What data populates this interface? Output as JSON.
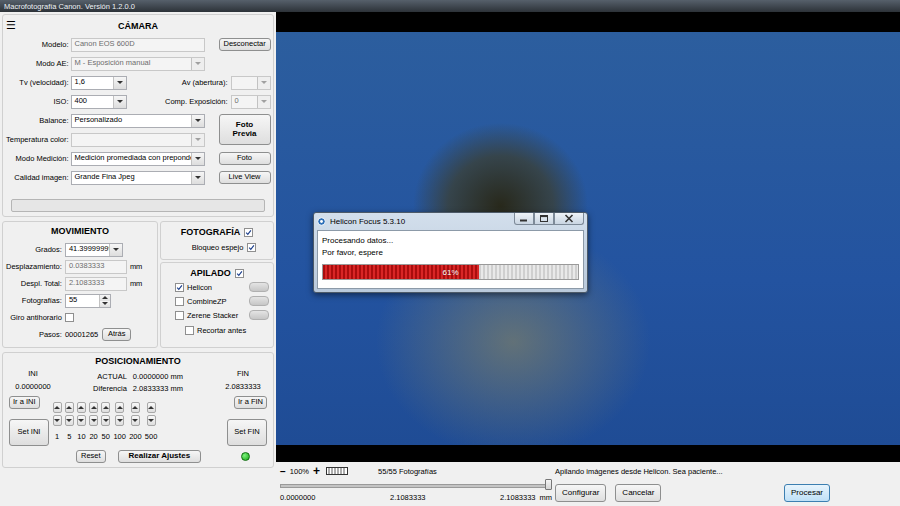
{
  "window": {
    "title": "Macrofotografía Canon. Versión 1.2.0.0"
  },
  "menu_icon": "☰",
  "camera": {
    "title": "CÁMARA",
    "rows": [
      {
        "kind": "text",
        "label": "Modelo:",
        "value": "Canon EOS 600D",
        "disabled": true,
        "button": {
          "label": "Desconectar",
          "primary": false
        }
      },
      {
        "kind": "select",
        "label": "Modo AE:",
        "value": "M - Esposición manual",
        "disabled": true
      },
      {
        "kind": "pair",
        "label": "Tv (velocidad):",
        "value": "1,6",
        "disabled": false,
        "label2": "Av (abertura):",
        "value2": "",
        "disabled2": true
      },
      {
        "kind": "pair",
        "label": "ISO:",
        "value": "400",
        "disabled": false,
        "label2": "Comp. Exposición:",
        "value2": "0",
        "disabled2": true
      },
      {
        "kind": "select",
        "label": "Balance:",
        "value": "Personalizado",
        "disabled": false,
        "button": {
          "label": "Foto Previa",
          "primary": true
        }
      },
      {
        "kind": "select",
        "label": "Temperatura color:",
        "value": "",
        "disabled": true
      },
      {
        "kind": "select",
        "label": "Modo Medición:",
        "value": "Medición promediada con preponder",
        "disabled": false,
        "button": {
          "label": "Foto",
          "primary": false
        }
      },
      {
        "kind": "select",
        "label": "Calidad imagen:",
        "value": "Grande Fina Jpeg",
        "disabled": false,
        "button": {
          "label": "Live View",
          "primary": false
        }
      }
    ],
    "progress": {
      "level": 0
    }
  },
  "movement": {
    "title": "MOVIMIENTO",
    "rows": [
      {
        "kind": "select",
        "label": "Grados:",
        "value": "41.39999999",
        "disabled": false
      },
      {
        "kind": "text",
        "label": "Desplazamiento:",
        "value": "0.0383333",
        "disabled": true,
        "unit": "mm"
      },
      {
        "kind": "text",
        "label": "Despl. Total:",
        "value": "2.1083333",
        "disabled": true,
        "unit": "mm"
      },
      {
        "kind": "spinner",
        "label": "Fotografías:",
        "value": "55",
        "disabled": false
      },
      {
        "kind": "checkbox",
        "label": "Giro antihorario",
        "checked": false
      },
      {
        "kind": "readout",
        "label": "Pasos:",
        "value": "00001265",
        "button": "Atrás"
      }
    ]
  },
  "photography": {
    "title": "FOTOGRAFÍA",
    "checked": true,
    "options": [
      {
        "label": "Bloqueo espejo",
        "checked": true
      }
    ]
  },
  "stacking": {
    "title": "APILADO",
    "checked": true,
    "engines": [
      {
        "label": "Helicon",
        "checked": true
      },
      {
        "label": "CombineZP",
        "checked": false
      },
      {
        "label": "Zerene Stacker",
        "checked": false
      }
    ],
    "crop": {
      "label": "Recortar antes",
      "checked": false
    }
  },
  "positioning": {
    "title": "POSICIONAMIENTO",
    "ini": {
      "label": "INI",
      "value": "0.0000000",
      "goto": "Ir a INI",
      "set": "Set INI"
    },
    "current": {
      "label": "ACTUAL",
      "value": "0.0000000 mm",
      "diff_label": "Diferencia",
      "diff_value": "2.0833333 mm"
    },
    "fin": {
      "label": "FIN",
      "value": "2.0833333",
      "goto": "Ir a FIN",
      "set": "Set FIN"
    },
    "steps": [
      "1",
      "5",
      "10",
      "20",
      "50",
      "100",
      "200",
      "500"
    ],
    "reset": "Reset",
    "apply": "Realizar Ajustes",
    "ready": true
  },
  "dialog": {
    "title": "Helicon Focus 5.3.10",
    "lines": [
      "Procesando datos...",
      "Por favor, espere"
    ],
    "progress": {
      "level": 0.61,
      "reading": "61%"
    }
  },
  "bottom": {
    "zoom": {
      "minus": "−",
      "value": "100%",
      "plus": "+"
    },
    "count": "55/55 Fotografías",
    "status": "Apilando imágenes desde Helicon. Sea paciente...",
    "slider": {
      "level": 1,
      "start": "0.0000000",
      "mid": "2.1083333",
      "end": "2.1083333",
      "unit": "mm"
    },
    "buttons": [
      {
        "label": "Configurar",
        "default": false
      },
      {
        "label": "Cancelar",
        "default": false
      },
      {
        "label": "Procesar",
        "default": true
      }
    ]
  }
}
